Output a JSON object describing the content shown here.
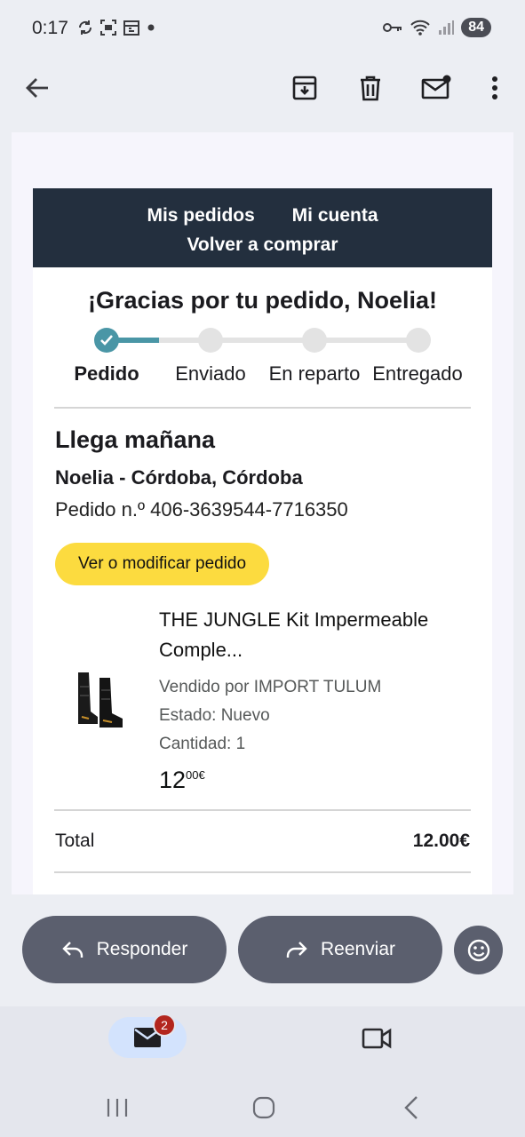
{
  "status_bar": {
    "time": "0:17",
    "battery": "84"
  },
  "app_bar": {
    "back_icon": "arrow-back-icon",
    "archive_icon": "archive-icon",
    "delete_icon": "trash-icon",
    "mark_unread_icon": "mail-unread-icon",
    "more_icon": "more-vert-icon"
  },
  "email": {
    "nav": {
      "my_orders": "Mis pedidos",
      "my_account": "Mi cuenta",
      "buy_again": "Volver a comprar"
    },
    "thanks": "¡Gracias por tu pedido, Noelia!",
    "steps": [
      "Pedido",
      "Enviado",
      "En reparto",
      "Entregado"
    ],
    "current_step": 1,
    "arrives": "Llega mañana",
    "address": "Noelia - Córdoba, Córdoba",
    "order_number": "Pedido n.º 406-3639544-7716350",
    "view_order_button": "Ver o modificar pedido",
    "product": {
      "title_line1": "THE JUNGLE Kit Impermeable",
      "title_line2": "Comple...",
      "seller": "Vendido por IMPORT TULUM",
      "condition": "Estado: Nuevo",
      "quantity": "Cantidad: 1",
      "price_whole": "12",
      "price_fraction": "00€"
    },
    "total_label": "Total",
    "total_value": "12.00€"
  },
  "actions": {
    "reply": "Responder",
    "forward": "Reenviar"
  },
  "bottom_nav": {
    "mail_badge": "2"
  },
  "colors": {
    "nav_band": "#232f3e",
    "tracker_done": "#4a96a6",
    "yellow_button": "#fcdb3f",
    "pill_button": "#5b5f6e",
    "badge": "#b3261e"
  }
}
